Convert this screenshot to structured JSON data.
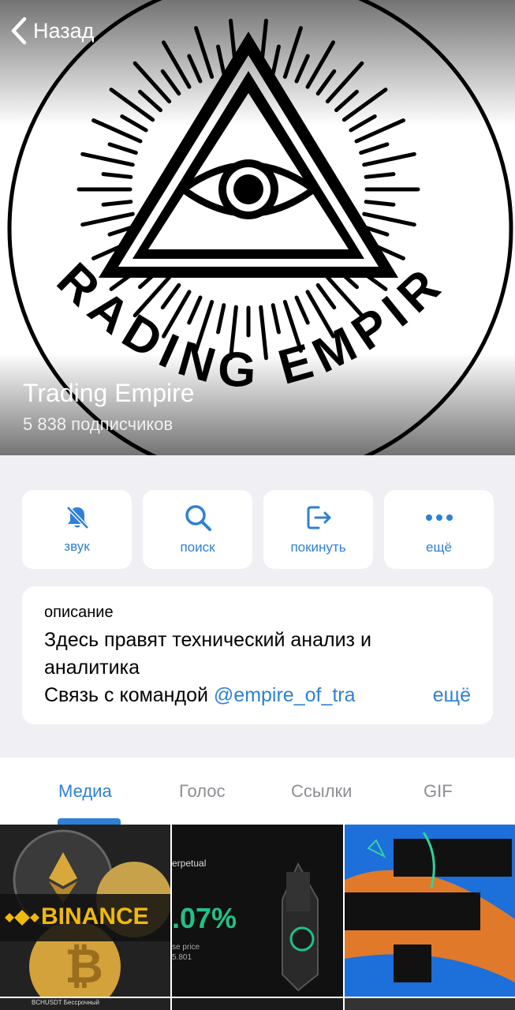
{
  "nav": {
    "back_label": "Назад"
  },
  "channel": {
    "title": "Trading Empire",
    "subscribers": "5 838 подписчиков",
    "avatar_text": "TRADING EMPIRE"
  },
  "actions": [
    {
      "label": "звук",
      "icon": "bell-slash-icon"
    },
    {
      "label": "поиск",
      "icon": "search-icon"
    },
    {
      "label": "покинуть",
      "icon": "leave-icon"
    },
    {
      "label": "ещё",
      "icon": "more-dots-icon"
    }
  ],
  "description": {
    "label": "описание",
    "text": "Здесь правят технический анализ и аналитика",
    "contact_prefix": "Связь с командой ",
    "mention": "@empire_of_tra",
    "more": "ещё"
  },
  "tabs": [
    {
      "label": "Медиа",
      "active": true
    },
    {
      "label": "Голос"
    },
    {
      "label": "Ссылки"
    },
    {
      "label": "GIF"
    }
  ],
  "media": {
    "thumb1_text": "BINANCE",
    "thumb2_text_top": "erpetual",
    "thumb2_big": ".07%",
    "thumb2_small": "se price",
    "thumb2_small2": "5.801",
    "thumb4_text": "BCHUSDT Бессрочный"
  },
  "colors": {
    "accent": "#2f80d6",
    "background": "#efeff4"
  }
}
